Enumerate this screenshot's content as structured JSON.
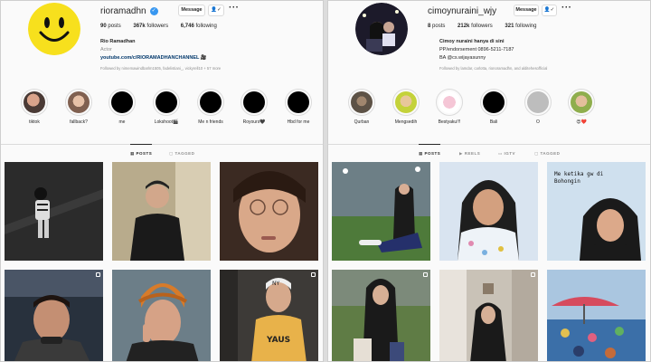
{
  "left": {
    "username": "rioramadhn",
    "message_label": "Message",
    "follow_icon": "person-check-icon",
    "more_icon": "more-icon",
    "stats": {
      "posts_count": "90",
      "posts_label": "posts",
      "followers_count": "367k",
      "followers_label": "followers",
      "following_count": "6,746",
      "following_label": "following"
    },
    "bio": {
      "name": "Rio Ramadhan",
      "category": "Actor",
      "link": "youtube.com/c/RIORAMADHANCHANNEL",
      "followed_by": "Followed by nimemawindbarlm1505, fadelistiani_, vickyrell10 + 57 more"
    },
    "highlights": [
      {
        "label": "tiktok"
      },
      {
        "label": "fallback?"
      },
      {
        "label": "me"
      },
      {
        "label": "Lokshoot🎬"
      },
      {
        "label": "Me n friends"
      },
      {
        "label": "Royours🖤"
      },
      {
        "label": "Hbd for me"
      }
    ],
    "tabs": [
      {
        "label": "POSTS",
        "active": true
      },
      {
        "label": "TAGGED",
        "active": false
      }
    ]
  },
  "right": {
    "username": "cimoynuraini_wjy",
    "message_label": "Message",
    "follow_icon": "person-check-icon",
    "more_icon": "more-icon",
    "stats": {
      "posts_count": "8",
      "posts_label": "posts",
      "followers_count": "212k",
      "followers_label": "followers",
      "following_count": "321",
      "following_label": "following"
    },
    "bio": {
      "name": "Cimoy nuraini hanya di sini",
      "line2": "PP/endorsement 0896-5211-7187",
      "line3": "BA @cs.wijayasunny",
      "followed_by": "Followed by lamdar, carlotta, rionoramadhn, and alditehesofficial"
    },
    "highlights": [
      {
        "label": "Qurban"
      },
      {
        "label": "Mengsedih"
      },
      {
        "label": "Bestyaku!!!"
      },
      {
        "label": "Bali"
      },
      {
        "label": "O"
      },
      {
        "label": "😍❤️"
      }
    ],
    "tabs": [
      {
        "label": "POSTS",
        "active": true
      },
      {
        "label": "REELS",
        "active": false
      },
      {
        "label": "IGTV",
        "active": false
      },
      {
        "label": "TAGGED",
        "active": false
      }
    ],
    "tile_caption": "Me ketika gw di Bohongin"
  },
  "colors": {
    "accent": "#3897f0",
    "link": "#00376b",
    "muted": "#8e8e8e",
    "smiley": "#f7e01d"
  }
}
